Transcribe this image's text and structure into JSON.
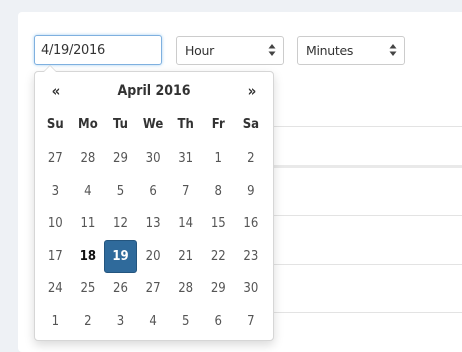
{
  "date_field": {
    "value": "4/19/2016"
  },
  "hour_select": {
    "value": "Hour"
  },
  "minutes_select": {
    "value": "Minutes"
  },
  "datepicker": {
    "prev": "«",
    "next": "»",
    "title": "April 2016",
    "weekdays": [
      "Su",
      "Mo",
      "Tu",
      "We",
      "Th",
      "Fr",
      "Sa"
    ],
    "weeks": [
      [
        "27",
        "28",
        "29",
        "30",
        "31",
        "1",
        "2"
      ],
      [
        "3",
        "4",
        "5",
        "6",
        "7",
        "8",
        "9"
      ],
      [
        "10",
        "11",
        "12",
        "13",
        "14",
        "15",
        "16"
      ],
      [
        "17",
        "18",
        "19",
        "20",
        "21",
        "22",
        "23"
      ],
      [
        "24",
        "25",
        "26",
        "27",
        "28",
        "29",
        "30"
      ],
      [
        "1",
        "2",
        "3",
        "4",
        "5",
        "6",
        "7"
      ]
    ],
    "selected_day": "19",
    "today_day": "18",
    "selected_color": "#2f6a9b"
  }
}
